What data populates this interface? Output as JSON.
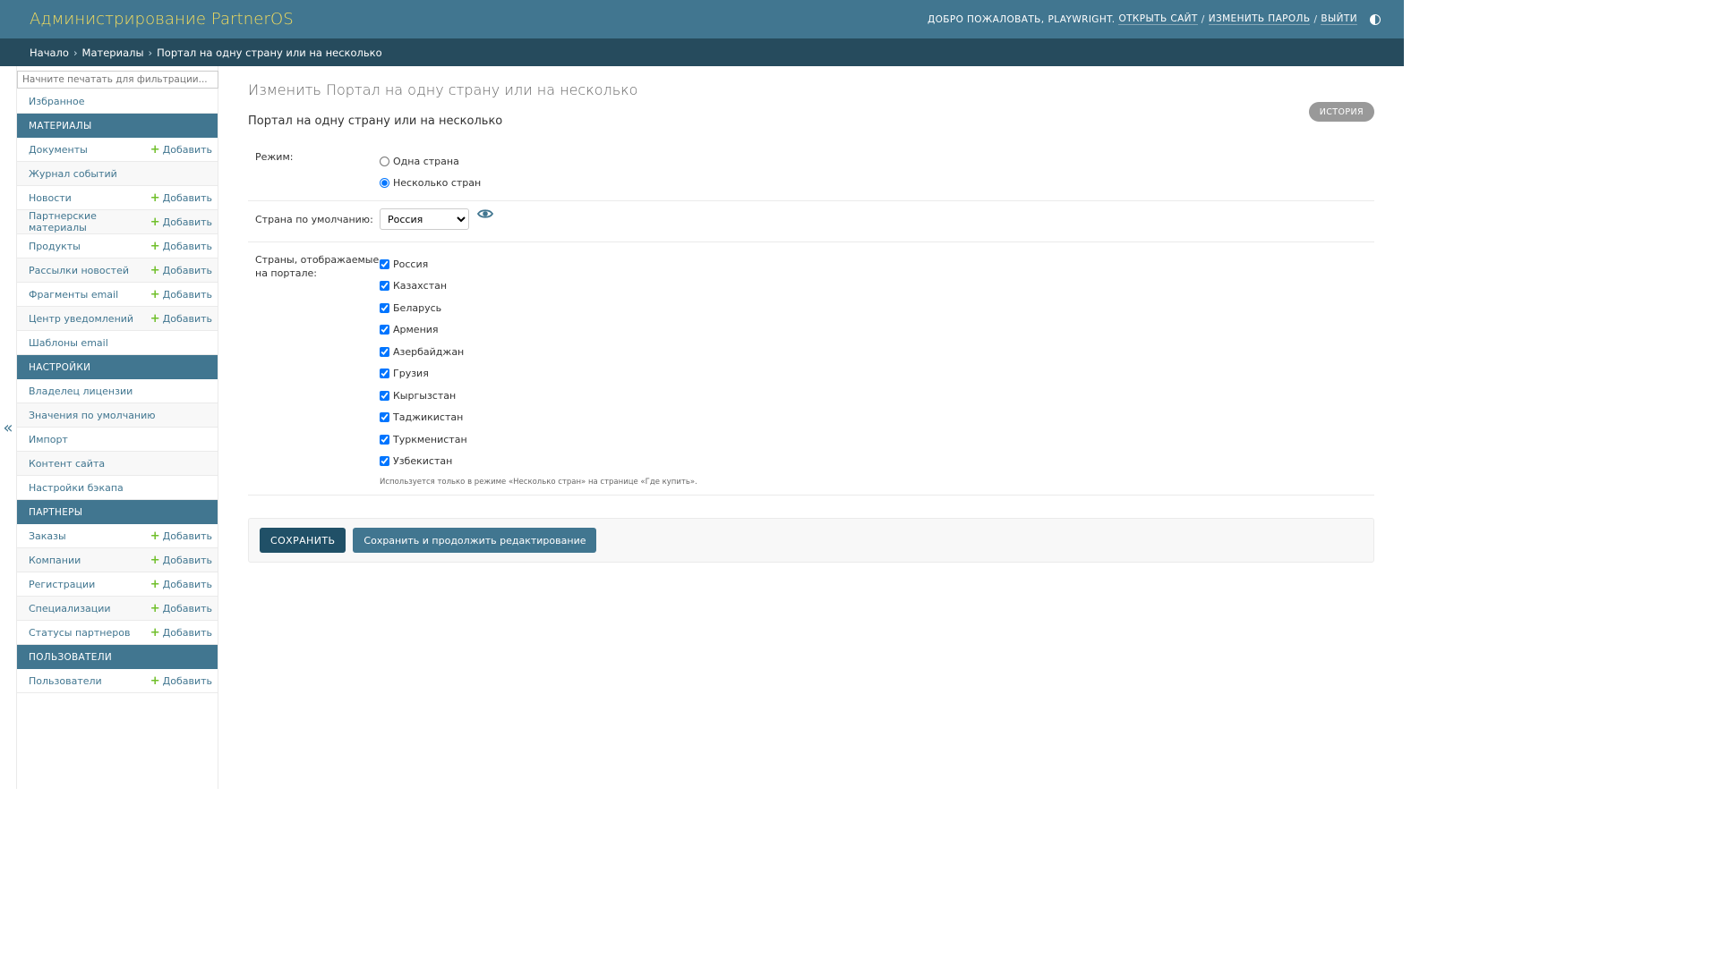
{
  "header": {
    "branding": "Администрирование PartnerOS",
    "welcome": "Добро пожаловать,",
    "username": "playwright.",
    "view_site": "Открыть сайт",
    "change_password": "Изменить пароль",
    "logout": "Выйти",
    "sep": "/"
  },
  "breadcrumbs": {
    "home": "Начало",
    "section": "Материалы",
    "current": "Портал на одну страну или на несколько",
    "sep": "›"
  },
  "sidebar": {
    "collapse": "«",
    "filter_placeholder": "Начните печатать для фильтрации...",
    "favorites": "Избранное",
    "add_label": "Добавить",
    "modules": [
      {
        "caption": "Материалы",
        "items": [
          {
            "label": "Документы",
            "add": true
          },
          {
            "label": "Журнал событий",
            "add": false
          },
          {
            "label": "Новости",
            "add": true
          },
          {
            "label": "Партнерские материалы",
            "add": true
          },
          {
            "label": "Продукты",
            "add": true
          },
          {
            "label": "Рассылки новостей",
            "add": true
          },
          {
            "label": "Фрагменты email",
            "add": true
          },
          {
            "label": "Центр уведомлений",
            "add": true
          },
          {
            "label": "Шаблоны email",
            "add": false
          }
        ]
      },
      {
        "caption": "Настройки",
        "items": [
          {
            "label": "Владелец лицензии",
            "add": false
          },
          {
            "label": "Значения по умолчанию",
            "add": false
          },
          {
            "label": "Импорт",
            "add": false
          },
          {
            "label": "Контент сайта",
            "add": false
          },
          {
            "label": "Настройки бэкапа",
            "add": false
          }
        ]
      },
      {
        "caption": "Партнеры",
        "items": [
          {
            "label": "Заказы",
            "add": true
          },
          {
            "label": "Компании",
            "add": true
          },
          {
            "label": "Регистрации",
            "add": true
          },
          {
            "label": "Специализации",
            "add": true
          },
          {
            "label": "Статусы партнеров",
            "add": true
          }
        ]
      },
      {
        "caption": "Пользователи",
        "items": [
          {
            "label": "Пользователи",
            "add": true
          }
        ]
      }
    ]
  },
  "content": {
    "title": "Изменить Портал на одну страну или на несколько",
    "history": "История",
    "object_name": "Портал на одну страну или на несколько",
    "mode": {
      "label": "Режим:",
      "options": [
        {
          "label": "Одна страна",
          "checked": false
        },
        {
          "label": "Несколько стран",
          "checked": true
        }
      ]
    },
    "default_country": {
      "label": "Страна по умолчанию:",
      "selected": "Россия"
    },
    "countries": {
      "label": "Страны, отображаемые на портале:",
      "items": [
        {
          "label": "Россия",
          "checked": true
        },
        {
          "label": "Казахстан",
          "checked": true
        },
        {
          "label": "Беларусь",
          "checked": true
        },
        {
          "label": "Армения",
          "checked": true
        },
        {
          "label": "Азербайджан",
          "checked": true
        },
        {
          "label": "Грузия",
          "checked": true
        },
        {
          "label": "Кыргызстан",
          "checked": true
        },
        {
          "label": "Таджикистан",
          "checked": true
        },
        {
          "label": "Туркменистан",
          "checked": true
        },
        {
          "label": "Узбекистан",
          "checked": true
        }
      ],
      "help": "Используется только в режиме «Несколько стран» на странице «Где купить»."
    },
    "save": "Сохранить",
    "save_continue": "Сохранить и продолжить редактирование"
  },
  "colors": {
    "header_bg": "#417690",
    "breadcrumbs_bg": "#264b5d",
    "branding": "#f5dd5d",
    "add_plus": "#70bf2b",
    "save_btn": "#205067"
  }
}
